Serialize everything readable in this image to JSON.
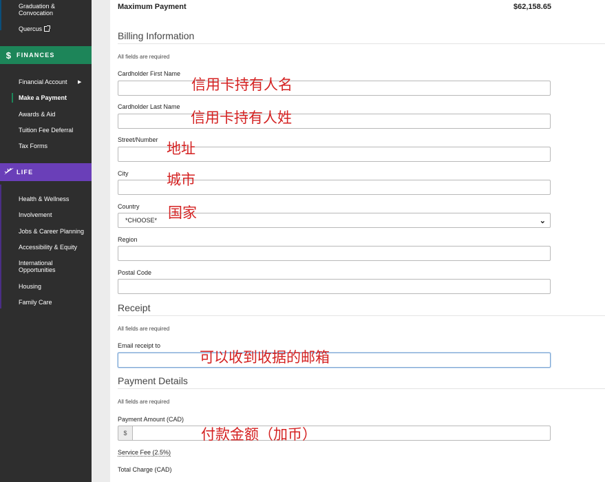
{
  "sidebar": {
    "top_items": [
      {
        "label": "Graduation & Convocation"
      },
      {
        "label": "Quercus"
      }
    ],
    "finances": {
      "title": "FINANCES",
      "icon": "dollar-icon",
      "items": [
        {
          "label": "Financial Account"
        },
        {
          "label": "Make a Payment"
        },
        {
          "label": "Awards & Aid"
        },
        {
          "label": "Tuition Fee Deferral"
        },
        {
          "label": "Tax Forms"
        }
      ]
    },
    "life": {
      "title": "LIFE",
      "icon": "leaf-icon",
      "items": [
        {
          "label": "Health & Wellness"
        },
        {
          "label": "Involvement"
        },
        {
          "label": "Jobs & Career Planning"
        },
        {
          "label": "Accessibility & Equity"
        },
        {
          "label": "International Opportunities"
        },
        {
          "label": "Housing"
        },
        {
          "label": "Family Care"
        }
      ]
    }
  },
  "summary": {
    "max_payment_label": "Maximum Payment",
    "max_payment_value": "$62,158.65"
  },
  "billing": {
    "title": "Billing Information",
    "required_note": "All fields are required",
    "first_name_label": "Cardholder First Name",
    "last_name_label": "Cardholder Last Name",
    "street_label": "Street/Number",
    "city_label": "City",
    "country_label": "Country",
    "country_value": "*CHOOSE*",
    "region_label": "Region",
    "postal_label": "Postal Code"
  },
  "receipt": {
    "title": "Receipt",
    "required_note": "All fields are required",
    "email_label": "Email receipt to"
  },
  "payment": {
    "title": "Payment Details",
    "required_note": "All fields are required",
    "amount_label": "Payment Amount (CAD)",
    "currency_symbol": "$",
    "service_fee_label": "Service Fee (2.5%)",
    "total_label": "Total Charge (CAD)"
  },
  "annotations": {
    "first_name": "信用卡持有人名",
    "last_name": "信用卡持有人姓",
    "street": "地址",
    "city": "城市",
    "country": "国家",
    "email": "可以收到收据的邮箱",
    "amount": "付款金额（加币）"
  },
  "colors": {
    "sidebar_bg": "#2e2e2e",
    "finances_accent": "#1d8559",
    "life_accent": "#6a3fb8",
    "annotation_red": "#d42222"
  }
}
